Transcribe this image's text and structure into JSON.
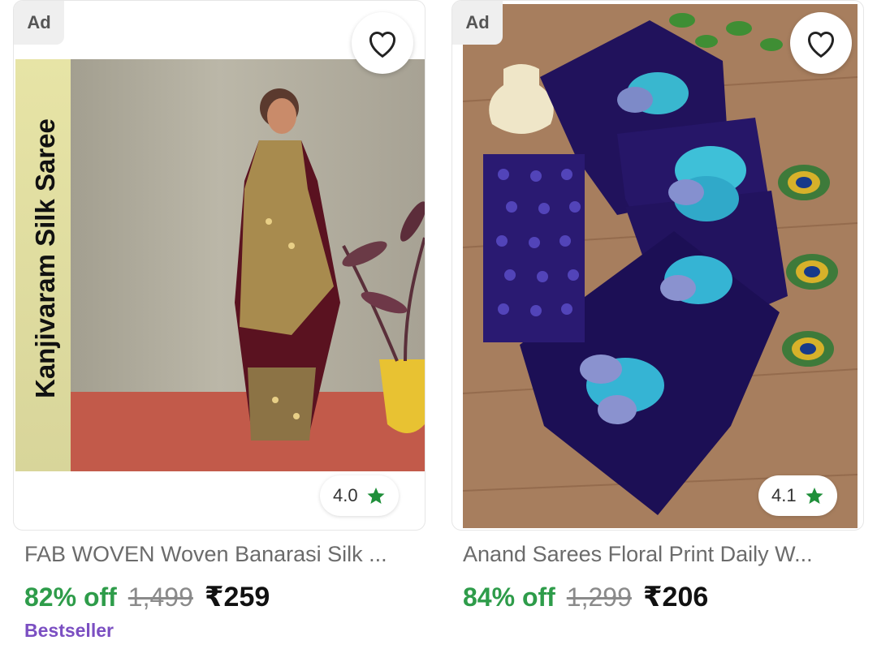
{
  "products": [
    {
      "ad_label": "Ad",
      "image_text": "Kanjivaram Silk Saree",
      "rating": "4.0",
      "title": "FAB WOVEN Woven Banarasi Silk ...",
      "discount": "82% off",
      "mrp": "1,499",
      "price": "₹259",
      "badge": "Bestseller"
    },
    {
      "ad_label": "Ad",
      "rating": "4.1",
      "title": "Anand Sarees Floral Print Daily W...",
      "discount": "84% off",
      "mrp": "1,299",
      "price": "₹206"
    }
  ],
  "colors": {
    "discount": "#2e9c4a",
    "badge": "#7b4fc2",
    "star": "#1f8f3a"
  },
  "icons": [
    "heart-outline-icon",
    "star-icon"
  ]
}
